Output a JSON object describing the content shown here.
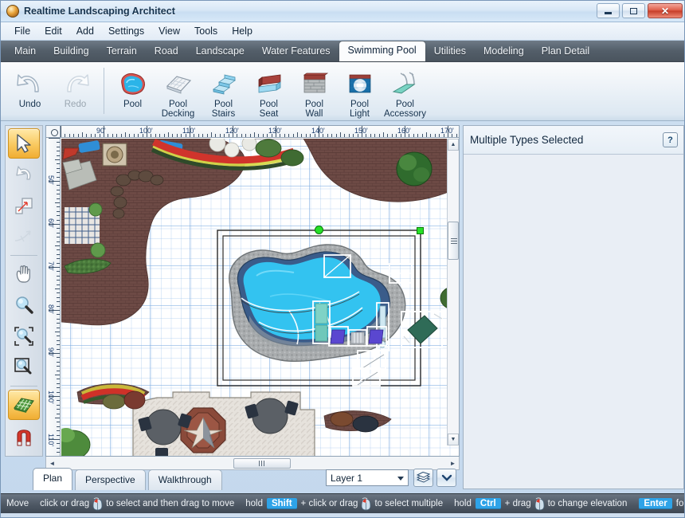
{
  "window": {
    "title": "Realtime Landscaping Architect",
    "app_icon": "app-globe-icon",
    "minimize_label": "Minimize",
    "maximize_label": "Maximize",
    "close_label": "✕"
  },
  "menu": {
    "items": [
      "File",
      "Edit",
      "Add",
      "Settings",
      "View",
      "Tools",
      "Help"
    ]
  },
  "tabs": {
    "active": "Swimming Pool",
    "items": [
      "Main",
      "Building",
      "Terrain",
      "Road",
      "Landscape",
      "Water Features",
      "Swimming Pool",
      "Utilities",
      "Modeling",
      "Plan Detail"
    ]
  },
  "ribbon": {
    "history": [
      {
        "label": "Undo",
        "icon": "undo-arrow-icon",
        "enabled": true
      },
      {
        "label": "Redo",
        "icon": "redo-arrow-icon",
        "enabled": false
      }
    ],
    "tools": [
      {
        "label_line1": "Pool",
        "label_line2": "",
        "icon": "pool-icon"
      },
      {
        "label_line1": "Pool",
        "label_line2": "Decking",
        "icon": "pool-decking-icon"
      },
      {
        "label_line1": "Pool",
        "label_line2": "Stairs",
        "icon": "pool-stairs-icon"
      },
      {
        "label_line1": "Pool",
        "label_line2": "Seat",
        "icon": "pool-seat-icon"
      },
      {
        "label_line1": "Pool",
        "label_line2": "Wall",
        "icon": "pool-wall-icon"
      },
      {
        "label_line1": "Pool",
        "label_line2": "Light",
        "icon": "pool-light-icon"
      },
      {
        "label_line1": "Pool",
        "label_line2": "Accessory",
        "icon": "pool-accessory-icon"
      }
    ]
  },
  "left_tools": [
    {
      "name": "select-tool",
      "icon": "arrow-cursor-icon",
      "selected": true,
      "enabled": true
    },
    {
      "name": "rotate-tool",
      "icon": "rotate-icon",
      "selected": false,
      "enabled": true
    },
    {
      "name": "resize-tool",
      "icon": "resize-icon",
      "selected": false,
      "enabled": true
    },
    {
      "name": "curve-tool",
      "icon": "curve-icon",
      "selected": false,
      "enabled": false
    },
    {
      "name": "pan-tool",
      "icon": "hand-icon",
      "selected": false,
      "enabled": true
    },
    {
      "name": "zoom-tool",
      "icon": "magnifier-icon",
      "selected": false,
      "enabled": true
    },
    {
      "name": "zoom-region-tool",
      "icon": "zoom-region-icon",
      "selected": false,
      "enabled": true
    },
    {
      "name": "zoom-out-tool",
      "icon": "zoom-out-icon",
      "selected": false,
      "enabled": true
    },
    {
      "name": "grid-toggle",
      "icon": "grid-icon",
      "selected": true,
      "enabled": true
    },
    {
      "name": "snap-toggle",
      "icon": "magnet-icon",
      "selected": false,
      "enabled": true
    }
  ],
  "plan": {
    "ruler_units": "ft",
    "ruler_h_labels": [
      "90'",
      "100'",
      "110'",
      "120'",
      "130'",
      "140'",
      "150'",
      "160'",
      "170'"
    ],
    "ruler_v_labels": [
      "50'",
      "60'",
      "70'",
      "80'",
      "90'",
      "100'",
      "110'"
    ],
    "selection": {
      "type": "multiple",
      "rotate_handle": "rotate-handle",
      "resize_handle": "resize-handle"
    }
  },
  "view_tabs": {
    "active": "Plan",
    "items": [
      "Plan",
      "Perspective",
      "Walkthrough"
    ]
  },
  "layer": {
    "selected": "Layer 1",
    "options": [
      "Layer 1"
    ],
    "layers_button_icon": "layers-stack-icon",
    "expand_button_icon": "chevron-down-icon"
  },
  "right_panel": {
    "title": "Multiple Types Selected",
    "help_label": "?"
  },
  "statusbar": {
    "mode": "Move",
    "segments": [
      {
        "pre": "click or drag",
        "icon": "mouse-icon",
        "post": "to select and then drag to move",
        "key": ""
      },
      {
        "pre": "hold",
        "key": "Shift",
        "mid": "+ click or drag",
        "icon": "mouse-icon",
        "post": "to select multiple"
      },
      {
        "pre": "hold",
        "key": "Ctrl",
        "mid": "+ drag",
        "icon": "mouse-icon",
        "post": "to change elevation"
      },
      {
        "key": "Enter",
        "post": "for keyboard"
      }
    ]
  },
  "colors": {
    "accent_blue": "#2ea3e8",
    "pool_water": "#36c6f0",
    "pool_coping": "#9aa0a4",
    "selection_green": "#27e027",
    "titlebar": "#d8e7f6",
    "tabstrip": "#535e69",
    "statusbar": "#4e5864",
    "brick": "#6d4a45"
  }
}
